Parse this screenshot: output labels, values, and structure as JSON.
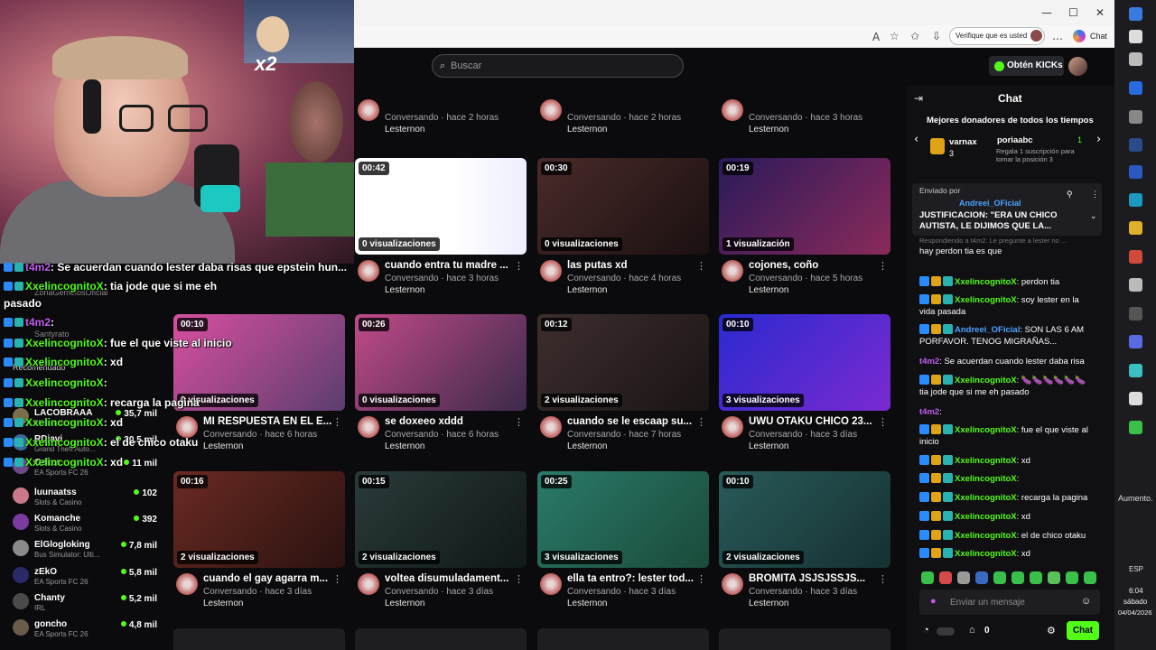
{
  "browser": {
    "verify_label": "Verifique que es usted",
    "copilot_label": "Chat",
    "minimize": "—",
    "maximize": "☐",
    "close": "✕",
    "tools": [
      "A͡",
      "☆",
      "⭐",
      "⇩",
      "…"
    ]
  },
  "header": {
    "search_placeholder": "Buscar",
    "kicks_label": "Obtén KICKs"
  },
  "webcam": {
    "multiplier": "x2"
  },
  "videos": [
    {
      "title": "",
      "meta": "Conversando · hace 2 horas",
      "channel": "Lesternon",
      "duration": "",
      "views": ""
    },
    {
      "title": "",
      "meta": "Conversando · hace 2 horas",
      "channel": "Lesternon",
      "duration": "",
      "views": ""
    },
    {
      "title": "",
      "meta": "Conversando · hace 3 horas",
      "channel": "Lesternon",
      "duration": "",
      "views": ""
    },
    {
      "title": "cuando entra tu madre ...",
      "meta": "Conversando · hace 3 horas",
      "channel": "Lesternon",
      "duration": "00:42",
      "views": "0 visualizaciones"
    },
    {
      "title": "las putas xd",
      "meta": "Conversando · hace 4 horas",
      "channel": "Lesternon",
      "duration": "00:30",
      "views": "0 visualizaciones"
    },
    {
      "title": "cojones, coño",
      "meta": "Conversando · hace 5 horas",
      "channel": "Lesternon",
      "duration": "00:19",
      "views": "1 visualización"
    },
    {
      "title": "MI RESPUESTA EN EL E...",
      "meta": "Conversando · hace 6 horas",
      "channel": "Lesternon",
      "duration": "00:10",
      "views": "0 visualizaciones"
    },
    {
      "title": "se doxeeo xddd",
      "meta": "Conversando · hace 6 horas",
      "channel": "Lesternon",
      "duration": "00:26",
      "views": "0 visualizaciones"
    },
    {
      "title": "cuando se le escaap su...",
      "meta": "Conversando · hace 7 horas",
      "channel": "Lesternon",
      "duration": "00:12",
      "views": "2 visualizaciones"
    },
    {
      "title": "UWU OTAKU CHICO 23...",
      "meta": "Conversando · hace 3 días",
      "channel": "Lesternon",
      "duration": "00:10",
      "views": "3 visualizaciones"
    },
    {
      "title": "cuando el gay agarra m...",
      "meta": "Conversando · hace 3 días",
      "channel": "Lesternon",
      "duration": "00:16",
      "views": "2 visualizaciones"
    },
    {
      "title": "voltea disumuladament...",
      "meta": "Conversando · hace 3 días",
      "channel": "Lesternon",
      "duration": "00:15",
      "views": "2 visualizaciones"
    },
    {
      "title": "ella ta entro?: lester tod...",
      "meta": "Conversando · hace 3 días",
      "channel": "Lesternon",
      "duration": "00:25",
      "views": "3 visualizaciones"
    },
    {
      "title": "BROMITA JSJSJSSJS...",
      "meta": "Conversando · hace 3 días",
      "channel": "Lesternon",
      "duration": "00:10",
      "views": "2 visualizaciones"
    }
  ],
  "overlay_chat": [
    {
      "user": "t4m2",
      "text": ": Se acuerdan cuando lester daba risas que epstein hun..."
    },
    {
      "user": "XxelincognitoX",
      "text": ": tia jode que si me eh"
    },
    {
      "user": "",
      "text": "pasado"
    },
    {
      "user": "t4m2",
      "text": ":"
    },
    {
      "user": "XxelincognitoX",
      "text": ": fue el que viste al inicio"
    },
    {
      "user": "XxelincognitoX",
      "text": ": xd"
    },
    {
      "user": "XxelincognitoX",
      "text": ":"
    },
    {
      "user": "XxelincognitoX",
      "text": ": recarga la pagina"
    },
    {
      "user": "XxelincognitoX",
      "text": ": xd"
    },
    {
      "user": "XxelincognitoX",
      "text": ": el de chico otaku"
    },
    {
      "user": "XxelincognitoX",
      "text": ": xd"
    }
  ],
  "recommended": {
    "heading": "Recomendado",
    "items": [
      {
        "name": "LACOBRAAA",
        "category": "Minecraft",
        "count": "35,7 mil"
      },
      {
        "name": "RDjavi",
        "category": "Grand Theft Auto...",
        "count": "30,5 mil"
      },
      {
        "name": "Coker",
        "category": "EA Sports FC 26",
        "count": "11 mil"
      },
      {
        "name": "luunaatss",
        "category": "Slots & Casino",
        "count": "102"
      },
      {
        "name": "Komanche",
        "category": "Slots & Casino",
        "count": "392"
      },
      {
        "name": "ElGlogloking",
        "category": "Bus Simulator: Ulti...",
        "count": "7,8 mil"
      },
      {
        "name": "zEkO",
        "category": "EA Sports FC 26",
        "count": "5,8 mil"
      },
      {
        "name": "Chanty",
        "category": "IRL",
        "count": "5,2 mil"
      },
      {
        "name": "goncho",
        "category": "EA Sports FC 26",
        "count": "4,8 mil"
      }
    ],
    "partial_names": [
      "ZonaGemelosOficial",
      "Santyrato"
    ]
  },
  "chat": {
    "title": "Chat",
    "donors_heading": "Mejores donadores de todos los tiempos",
    "donor1_name": "varnax",
    "donor1_count": "3",
    "donor2_name": "poriaabc",
    "donor2_count": "1",
    "donor2_note": "Regala 1 suscripción para tomar la posición 3",
    "pinned_label": "Enviado por",
    "pinned_user": "Andreei_OFicial",
    "pinned_text": "JUSTIFICACION: \"ERA UN CHICO AUTISTA, LE DIJIMOS QUE LA...",
    "reply_hint": "Respondiendo a t4m2: Le pregunte a lester no ...",
    "messages": [
      {
        "user": "",
        "text": "hay perdon tia es que",
        "prefix": true,
        "user_label": "XxelincognitoX"
      },
      {
        "user": "XxelincognitoX",
        "text": ": perdon tia"
      },
      {
        "user": "XxelincognitoX",
        "text": ": soy lester en la vida pasada"
      },
      {
        "user": "Andreei_OFicial",
        "text": ": SON LAS 6 AM PORFAVOR. TENOG MIGRAÑAS..."
      },
      {
        "user": "t4m2",
        "text": ": Se acuerdan cuando lester daba risa"
      },
      {
        "user": "XxelincognitoX",
        "text": ": 🍆🍆🍆🍆🍆🍆 tia jode que si me eh pasado"
      },
      {
        "user": "t4m2",
        "text": ":"
      },
      {
        "user": "XxelincognitoX",
        "text": ": fue el que viste al inicio"
      },
      {
        "user": "XxelincognitoX",
        "text": ": xd"
      },
      {
        "user": "XxelincognitoX",
        "text": ":"
      },
      {
        "user": "XxelincognitoX",
        "text": ": recarga la pagina"
      },
      {
        "user": "XxelincognitoX",
        "text": ": xd"
      },
      {
        "user": "XxelincognitoX",
        "text": ": el de chico otaku"
      },
      {
        "user": "XxelincognitoX",
        "text": ": xd"
      }
    ],
    "input_placeholder": "Enviar un mensaje",
    "points_count": "0",
    "send_label": "Chat"
  },
  "taskbar": {
    "aumento": "Aumento.",
    "lang": "ESP",
    "time": "6:04",
    "day": "sábado",
    "date": "04/04/2026"
  },
  "colors": {
    "kick_green": "#53fc18",
    "bg": "#0b0b0d",
    "panel": "#101013"
  }
}
